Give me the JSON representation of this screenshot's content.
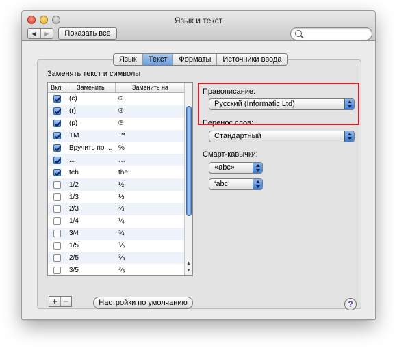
{
  "window": {
    "title": "Язык и текст"
  },
  "toolbar": {
    "back_label": "◀",
    "forward_label": "▶",
    "show_all_label": "Показать все",
    "search_value": ""
  },
  "tabs": [
    {
      "label": "Язык",
      "active": false
    },
    {
      "label": "Текст",
      "active": true
    },
    {
      "label": "Форматы",
      "active": false
    },
    {
      "label": "Источники ввода",
      "active": false
    }
  ],
  "replace": {
    "section_label": "Заменять текст и символы",
    "columns": [
      "Вкл.",
      "Заменить",
      "Заменить на"
    ],
    "rows": [
      {
        "enabled": true,
        "replace": "(c)",
        "with": "©"
      },
      {
        "enabled": true,
        "replace": "(r)",
        "with": "®"
      },
      {
        "enabled": true,
        "replace": "(p)",
        "with": "℗"
      },
      {
        "enabled": true,
        "replace": "TM",
        "with": "™"
      },
      {
        "enabled": true,
        "replace": "Вручить по ...",
        "with": "℅"
      },
      {
        "enabled": true,
        "replace": "...",
        "with": "…"
      },
      {
        "enabled": true,
        "replace": "teh",
        "with": "the"
      },
      {
        "enabled": false,
        "replace": "1/2",
        "with": "½"
      },
      {
        "enabled": false,
        "replace": "1/3",
        "with": "⅓"
      },
      {
        "enabled": false,
        "replace": "2/3",
        "with": "⅔"
      },
      {
        "enabled": false,
        "replace": "1/4",
        "with": "¼"
      },
      {
        "enabled": false,
        "replace": "3/4",
        "with": "¾"
      },
      {
        "enabled": false,
        "replace": "1/5",
        "with": "⅕"
      },
      {
        "enabled": false,
        "replace": "2/5",
        "with": "⅖"
      },
      {
        "enabled": false,
        "replace": "3/5",
        "with": "⅗"
      }
    ],
    "add_label": "+",
    "remove_label": "−",
    "defaults_label": "Настройки по умолчанию"
  },
  "spelling": {
    "label": "Правописание:",
    "value": "Русский (Informatic Ltd)"
  },
  "hyphenation": {
    "label": "Перенос слов:",
    "value": "Стандартный"
  },
  "smart_quotes": {
    "label": "Смарт-кавычки:",
    "double_value": "«abc»",
    "single_value": "‘abc’"
  },
  "help_label": "?",
  "colors": {
    "accent": "#4a86d8",
    "highlight": "#e01b24"
  }
}
